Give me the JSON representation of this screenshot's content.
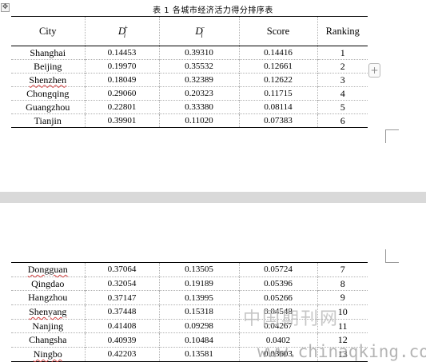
{
  "caption": "表 1 各城市经济活力得分排序表",
  "add_button": "+",
  "table": {
    "headers": {
      "city": "City",
      "d_plus_symbol": "D",
      "d_plus_sup": "+",
      "d_plus_sub": "i",
      "d_minus_symbol": "D",
      "d_minus_sup": "−",
      "d_minus_sub": "i",
      "score": "Score",
      "ranking": "Ranking"
    },
    "rows_page1": [
      {
        "city": "Shanghai",
        "d_plus": "0.14453",
        "d_minus": "0.39310",
        "score": "0.14416",
        "rank": "1"
      },
      {
        "city": "Beijing",
        "d_plus": "0.19970",
        "d_minus": "0.35532",
        "score": "0.12661",
        "rank": "2"
      },
      {
        "city": "Shenzhen",
        "d_plus": "0.18049",
        "d_minus": "0.32389",
        "score": "0.12622",
        "rank": "3"
      },
      {
        "city": "Chongqing",
        "d_plus": "0.29060",
        "d_minus": "0.20323",
        "score": "0.11715",
        "rank": "4"
      },
      {
        "city": "Guangzhou",
        "d_plus": "0.22801",
        "d_minus": "0.33380",
        "score": "0.08114",
        "rank": "5"
      },
      {
        "city": "Tianjin",
        "d_plus": "0.39901",
        "d_minus": "0.11020",
        "score": "0.07383",
        "rank": "6"
      }
    ],
    "rows_page2": [
      {
        "city": "Dongguan",
        "d_plus": "0.37064",
        "d_minus": "0.13505",
        "score": "0.05724",
        "rank": "7"
      },
      {
        "city": "Qingdao",
        "d_plus": "0.32054",
        "d_minus": "0.19189",
        "score": "0.05396",
        "rank": "8"
      },
      {
        "city": "Hangzhou",
        "d_plus": "0.37147",
        "d_minus": "0.13995",
        "score": "0.05266",
        "rank": "9"
      },
      {
        "city": "Shenyang",
        "d_plus": "0.37448",
        "d_minus": "0.15318",
        "score": "0.04548",
        "rank": "10"
      },
      {
        "city": "Nanjing",
        "d_plus": "0.41408",
        "d_minus": "0.09298",
        "score": "0.04267",
        "rank": "11"
      },
      {
        "city": "Changsha",
        "d_plus": "0.40939",
        "d_minus": "0.10484",
        "score": "0.0402",
        "rank": "12"
      },
      {
        "city": "Ningbo",
        "d_plus": "0.42203",
        "d_minus": "0.13581",
        "score": "0.03603",
        "rank": "13"
      }
    ]
  },
  "watermark": {
    "text_cn": "中国期刊网",
    "text_url": "www.chinaqking.com"
  },
  "colors": {
    "page_gap": "#d9d9d9",
    "spell_check_underline": "#d04040"
  }
}
